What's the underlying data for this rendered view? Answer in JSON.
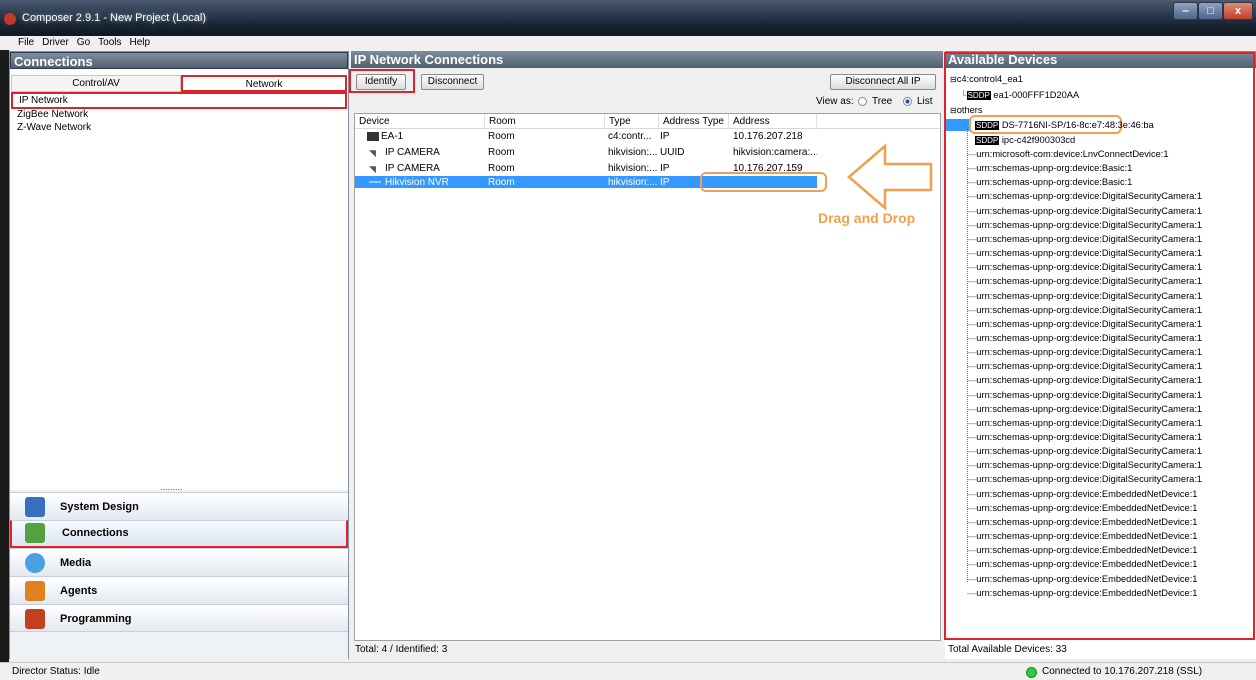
{
  "window": {
    "title": "Composer 2.9.1 - New Project (Local)",
    "controls": [
      "‒",
      "□",
      "x"
    ]
  },
  "menu": [
    "File",
    "Driver",
    "Go",
    "Tools",
    "Help"
  ],
  "left_panel": {
    "title": "Connections",
    "tabs": [
      "Control/AV",
      "Network"
    ],
    "networks": [
      "IP Network",
      "ZigBee Network",
      "Z-Wave Network"
    ],
    "splitter": ".........",
    "nav": [
      {
        "label": "System Design",
        "icon": "system-design-icon",
        "color": "#3a6fc0"
      },
      {
        "label": "Connections",
        "icon": "connections-icon",
        "color": "#55a040"
      },
      {
        "label": "Media",
        "icon": "media-icon",
        "color": "#4aa0e0"
      },
      {
        "label": "Agents",
        "icon": "agents-icon",
        "color": "#e08020"
      },
      {
        "label": "Programming",
        "icon": "programming-icon",
        "color": "#c04020"
      }
    ]
  },
  "middle_panel": {
    "title": "IP Network Connections",
    "identify": "Identify",
    "disconnect": "Disconnect",
    "disconnect_all": "Disconnect All IP",
    "view_as": "View as:",
    "view_tree": "Tree",
    "view_list": "List",
    "columns": [
      "Device",
      "Room",
      "Type",
      "Address Type",
      "Address"
    ],
    "rows": [
      {
        "device": "EA-1",
        "room": "Room",
        "type": "c4:contr...",
        "addr_type": "IP",
        "address": "10.176.207.218"
      },
      {
        "device": "IP CAMERA",
        "room": "Room",
        "type": "hikvision:...",
        "addr_type": "UUID",
        "address": "hikvision:camera:..."
      },
      {
        "device": "IP CAMERA",
        "room": "Room",
        "type": "hikvision:...",
        "addr_type": "IP",
        "address": "10.176.207.159"
      },
      {
        "device": "Hikvision NVR",
        "room": "Room",
        "type": "hikvision:...",
        "addr_type": "IP",
        "address": ""
      }
    ],
    "annotation": "Drag and Drop",
    "status": "Total: 4 / Identified: 3"
  },
  "right_panel": {
    "title": "Available Devices",
    "group1": "c4:control4_ea1",
    "group1_item": "ea1-000FFF1D20AA",
    "group2": "others",
    "sddp_badge": "SDDP",
    "sddp_items": [
      "DS-7716NI-SP/16-8c:e7:48:3e:46:ba",
      "ipc-c42f900303cd"
    ],
    "items": [
      "urn:microsoft-com:device:LnvConnectDevice:1",
      "urn:schemas-upnp-org:device:Basic:1",
      "urn:schemas-upnp-org:device:Basic:1",
      "urn:schemas-upnp-org:device:DigitalSecurityCamera:1",
      "urn:schemas-upnp-org:device:DigitalSecurityCamera:1",
      "urn:schemas-upnp-org:device:DigitalSecurityCamera:1",
      "urn:schemas-upnp-org:device:DigitalSecurityCamera:1",
      "urn:schemas-upnp-org:device:DigitalSecurityCamera:1",
      "urn:schemas-upnp-org:device:DigitalSecurityCamera:1",
      "urn:schemas-upnp-org:device:DigitalSecurityCamera:1",
      "urn:schemas-upnp-org:device:DigitalSecurityCamera:1",
      "urn:schemas-upnp-org:device:DigitalSecurityCamera:1",
      "urn:schemas-upnp-org:device:DigitalSecurityCamera:1",
      "urn:schemas-upnp-org:device:DigitalSecurityCamera:1",
      "urn:schemas-upnp-org:device:DigitalSecurityCamera:1",
      "urn:schemas-upnp-org:device:DigitalSecurityCamera:1",
      "urn:schemas-upnp-org:device:DigitalSecurityCamera:1",
      "urn:schemas-upnp-org:device:DigitalSecurityCamera:1",
      "urn:schemas-upnp-org:device:DigitalSecurityCamera:1",
      "urn:schemas-upnp-org:device:DigitalSecurityCamera:1",
      "urn:schemas-upnp-org:device:DigitalSecurityCamera:1",
      "urn:schemas-upnp-org:device:DigitalSecurityCamera:1",
      "urn:schemas-upnp-org:device:DigitalSecurityCamera:1",
      "urn:schemas-upnp-org:device:DigitalSecurityCamera:1",
      "urn:schemas-upnp-org:device:EmbeddedNetDevice:1",
      "urn:schemas-upnp-org:device:EmbeddedNetDevice:1",
      "urn:schemas-upnp-org:device:EmbeddedNetDevice:1",
      "urn:schemas-upnp-org:device:EmbeddedNetDevice:1",
      "urn:schemas-upnp-org:device:EmbeddedNetDevice:1",
      "urn:schemas-upnp-org:device:EmbeddedNetDevice:1",
      "urn:schemas-upnp-org:device:EmbeddedNetDevice:1",
      "urn:schemas-upnp-org:device:EmbeddedNetDevice:1"
    ],
    "status": "Total Available Devices: 33"
  },
  "statusbar": {
    "director": "Director Status: Idle",
    "connection": "Connected to 10.176.207.218 (SSL)",
    "connection_color": "#2ecc40"
  },
  "colors": {
    "highlight_red": "#e0232a",
    "annotation_orange": "#f0a050",
    "selection": "#3399ff"
  }
}
